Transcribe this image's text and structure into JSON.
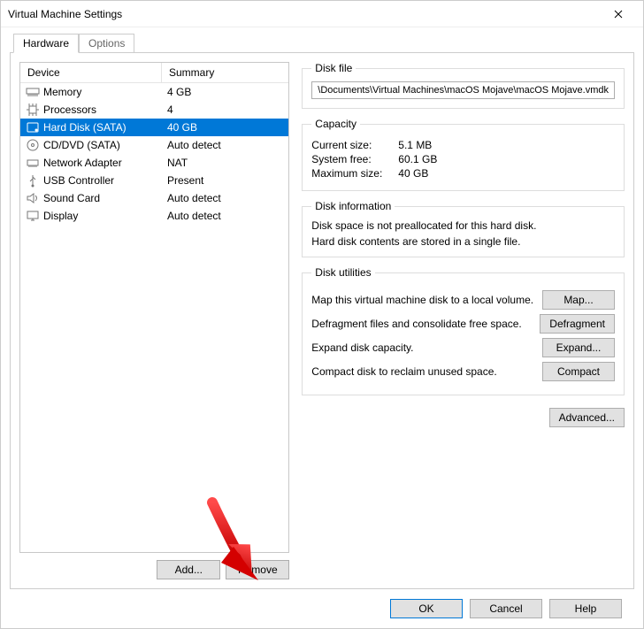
{
  "window": {
    "title": "Virtual Machine Settings"
  },
  "tabs": {
    "hardware": "Hardware",
    "options": "Options"
  },
  "device_table": {
    "header": {
      "device": "Device",
      "summary": "Summary"
    },
    "rows": [
      {
        "icon": "memory-icon",
        "name": "Memory",
        "summary": "4 GB",
        "selected": false
      },
      {
        "icon": "cpu-icon",
        "name": "Processors",
        "summary": "4",
        "selected": false
      },
      {
        "icon": "disk-icon",
        "name": "Hard Disk (SATA)",
        "summary": "40 GB",
        "selected": true
      },
      {
        "icon": "cd-icon",
        "name": "CD/DVD (SATA)",
        "summary": "Auto detect",
        "selected": false
      },
      {
        "icon": "nic-icon",
        "name": "Network Adapter",
        "summary": "NAT",
        "selected": false
      },
      {
        "icon": "usb-icon",
        "name": "USB Controller",
        "summary": "Present",
        "selected": false
      },
      {
        "icon": "sound-icon",
        "name": "Sound Card",
        "summary": "Auto detect",
        "selected": false
      },
      {
        "icon": "display-icon",
        "name": "Display",
        "summary": "Auto detect",
        "selected": false
      }
    ]
  },
  "left_buttons": {
    "add": "Add...",
    "remove": "Remove"
  },
  "disk_file": {
    "legend": "Disk file",
    "path": "\\Documents\\Virtual Machines\\macOS Mojave\\macOS Mojave.vmdk"
  },
  "capacity": {
    "legend": "Capacity",
    "current_label": "Current size:",
    "current_val": "5.1 MB",
    "free_label": "System free:",
    "free_val": "60.1 GB",
    "max_label": "Maximum size:",
    "max_val": "40 GB"
  },
  "disk_info": {
    "legend": "Disk information",
    "line1": "Disk space is not preallocated for this hard disk.",
    "line2": "Hard disk contents are stored in a single file."
  },
  "disk_util": {
    "legend": "Disk utilities",
    "map_text": "Map this virtual machine disk to a local volume.",
    "map_btn": "Map...",
    "defrag_text": "Defragment files and consolidate free space.",
    "defrag_btn": "Defragment",
    "expand_text": "Expand disk capacity.",
    "expand_btn": "Expand...",
    "compact_text": "Compact disk to reclaim unused space.",
    "compact_btn": "Compact"
  },
  "advanced_btn": "Advanced...",
  "footer": {
    "ok": "OK",
    "cancel": "Cancel",
    "help": "Help"
  }
}
